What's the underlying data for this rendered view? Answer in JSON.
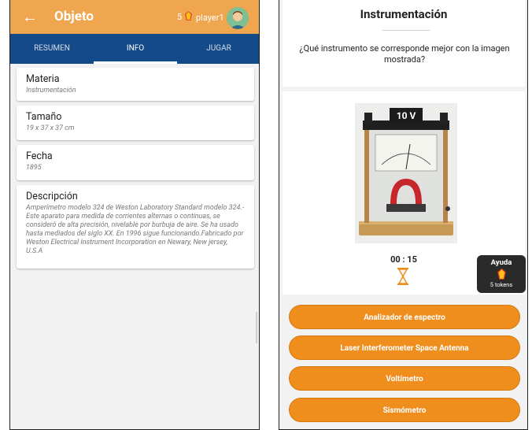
{
  "left": {
    "appbar": {
      "title": "Objeto",
      "tokens": "5",
      "player": "player1"
    },
    "tabs": [
      {
        "label": "RESUMEN"
      },
      {
        "label": "INFO"
      },
      {
        "label": "JUGAR"
      }
    ],
    "cards": [
      {
        "label": "Materia",
        "value": "Instrumentación"
      },
      {
        "label": "Tamaño",
        "value": "19 x 37 x 37 cm"
      },
      {
        "label": "Fecha",
        "value": "1895"
      },
      {
        "label": "Descripción",
        "value": "Amperímetro modelo 324 de Weston Laboratory Standard modelo 324.- Este aparato para medida de corrientes alternas o continuas, se consideró de alta precisión, nivelable por burbuja de aire. Se ha usado hasta mediados del siglo XX. En 1996 sigue funcionando.Fabricado por Weston Electrical Instrument Incorporation en Newary, New jersey, U.S.A"
      }
    ]
  },
  "right": {
    "title": "Instrumentación",
    "question": "¿Qué instrumento se corresponde mejor con la imagen mostrada?",
    "photo_label": "10 V",
    "timer": "00 : 15",
    "help": {
      "title": "Ayuda",
      "tokens": "5 tokens"
    },
    "answers": [
      "Analizador de espectro",
      "Laser Interferometer Space Antenna",
      "Voltímetro",
      "Sismómetro"
    ]
  },
  "colors": {
    "appbar": "#f0a64f",
    "tabs": "#154a8a",
    "answer": "#ef8d1d",
    "help_bg": "#2a2a2a"
  }
}
